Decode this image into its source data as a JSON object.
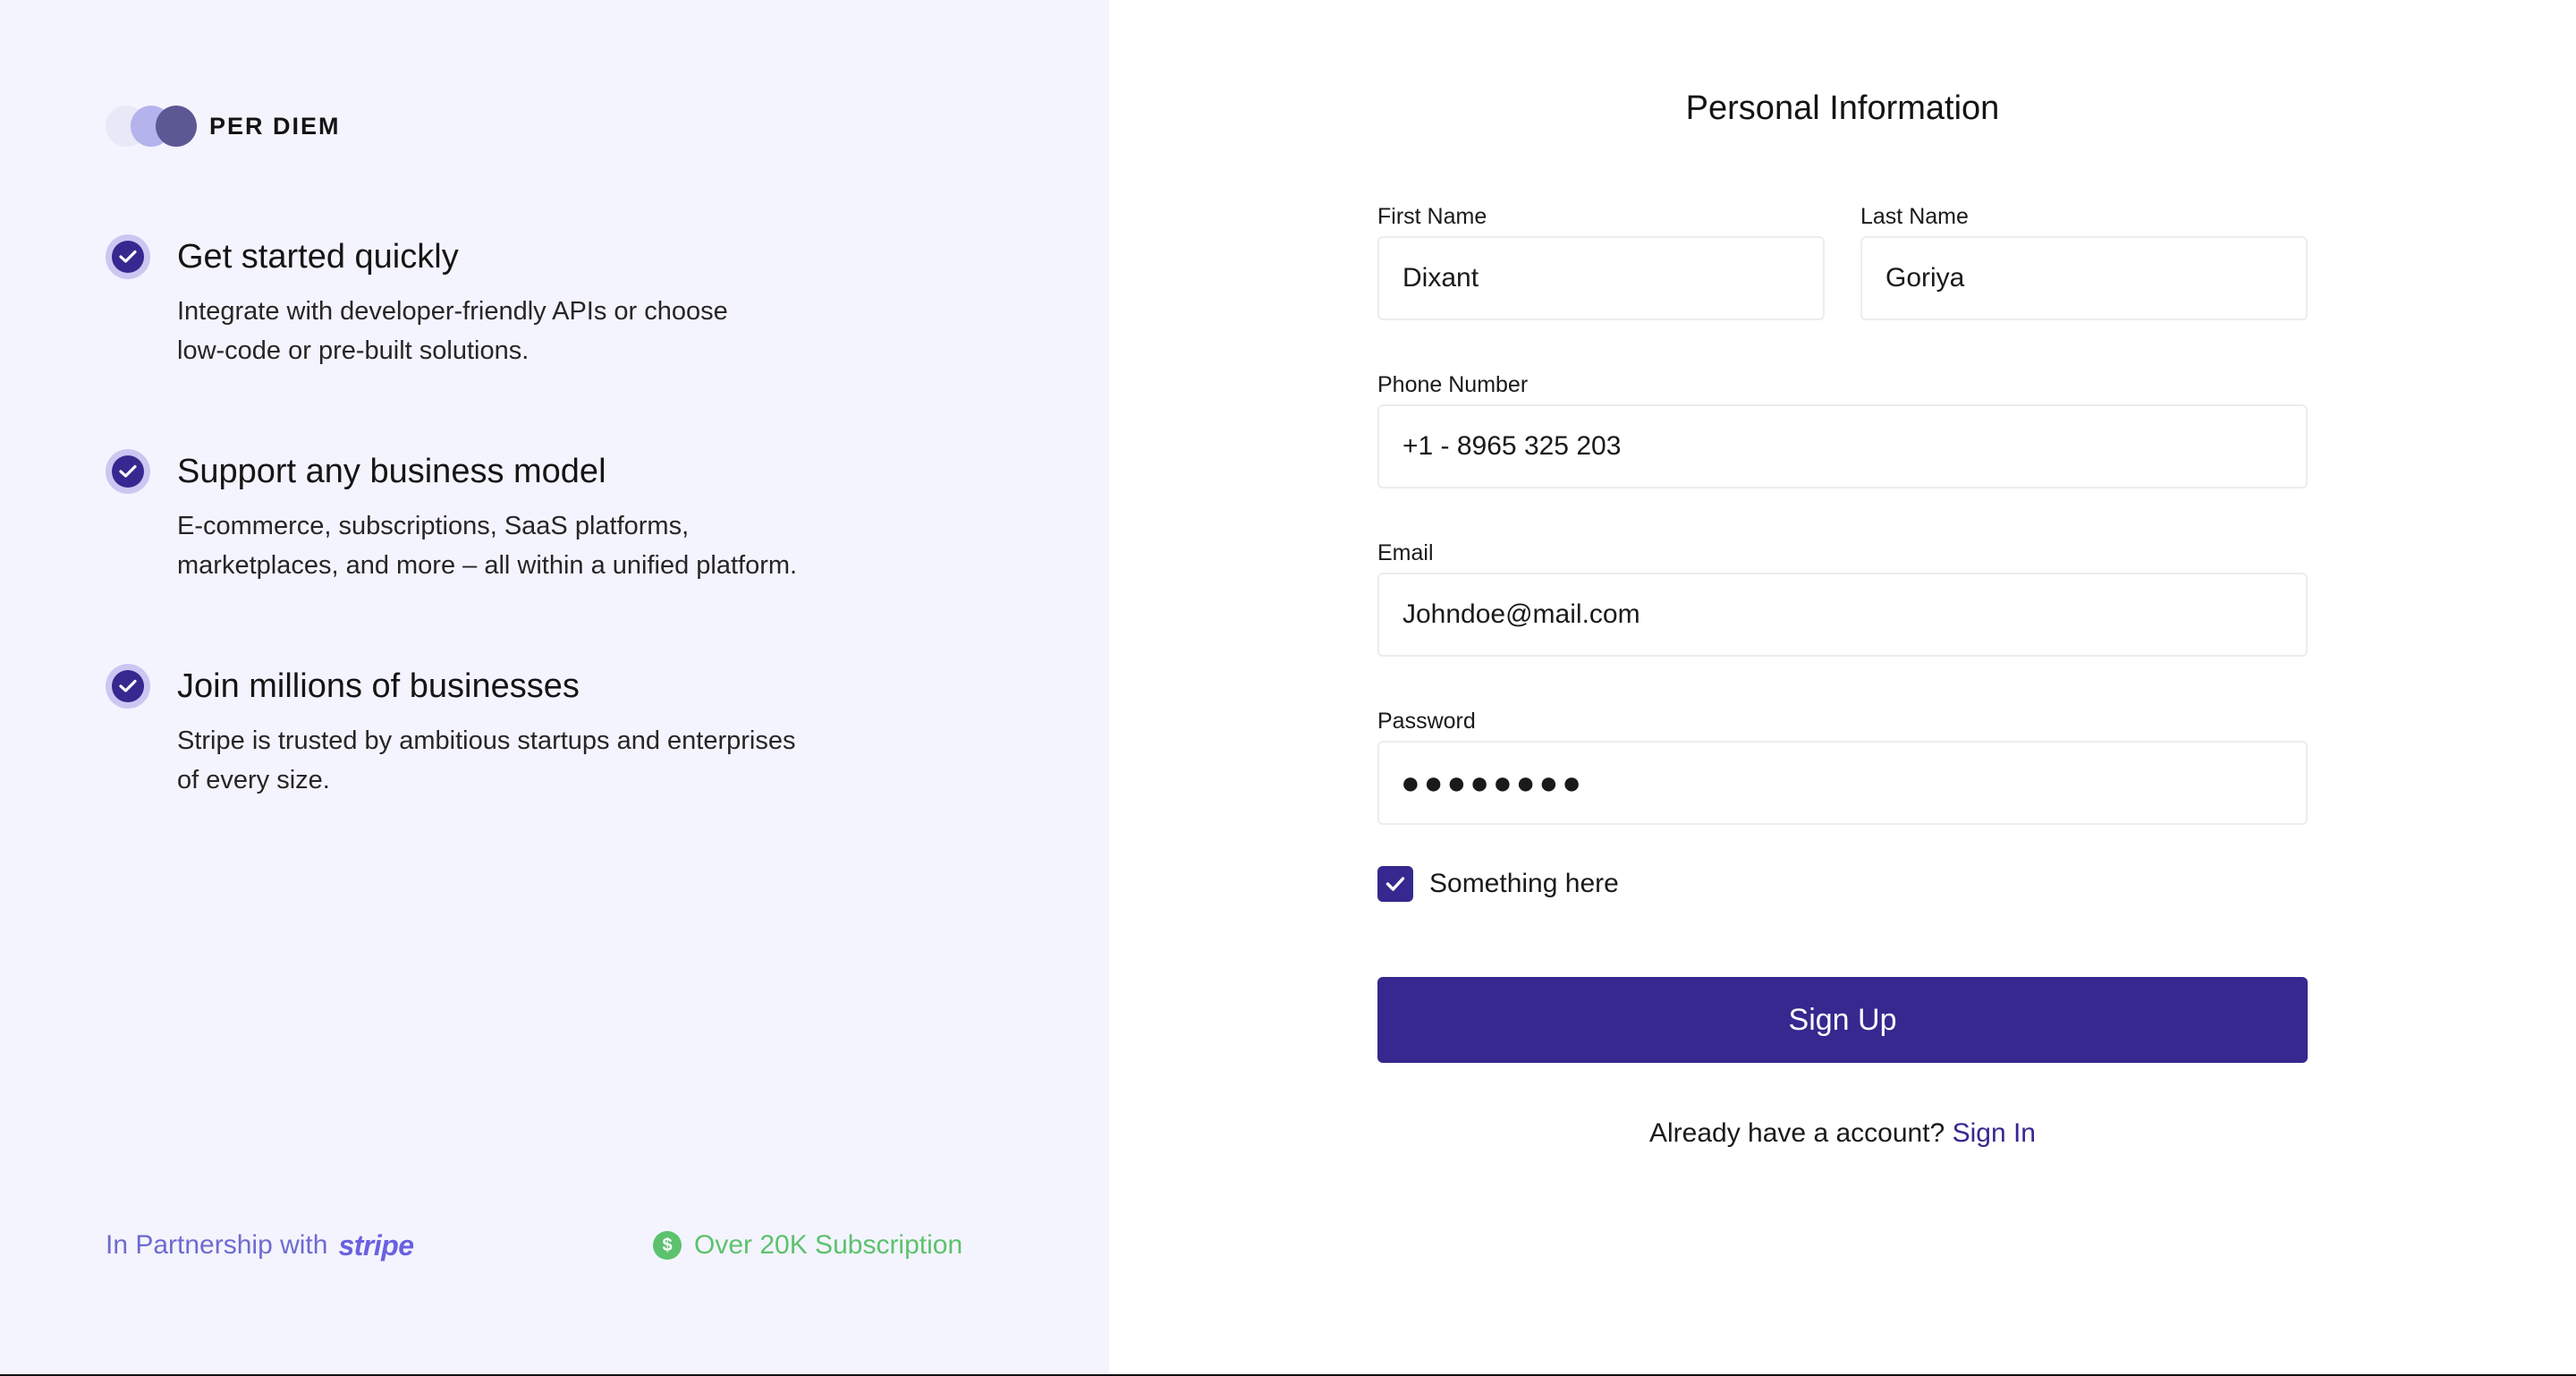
{
  "brand": {
    "name": "PER DIEM"
  },
  "features": [
    {
      "title": "Get started quickly",
      "desc_line1": "Integrate with developer-friendly APIs or choose",
      "desc_line2": "low-code or pre-built solutions."
    },
    {
      "title": "Support any business model",
      "desc_line1": "E-commerce, subscriptions, SaaS platforms,",
      "desc_line2": "marketplaces, and more – all within a unified platform."
    },
    {
      "title": "Join millions of businesses",
      "desc_line1": "Stripe is trusted by ambitious startups and enterprises",
      "desc_line2": "of every size."
    }
  ],
  "footer": {
    "partner_text": "In Partnership with",
    "partner_brand": "stripe",
    "subscription_text": "Over 20K Subscription",
    "subscription_icon": "$"
  },
  "form": {
    "title": "Personal Information",
    "first_name": {
      "label": "First Name",
      "value": "Dixant"
    },
    "last_name": {
      "label": "Last Name",
      "value": "Goriya"
    },
    "phone": {
      "label": "Phone Number",
      "value": "+1 - 8965 325 203"
    },
    "email": {
      "label": "Email",
      "value": "Johndoe@mail.com"
    },
    "password": {
      "label": "Password",
      "masked": "●●●●●●●●"
    },
    "checkbox": {
      "label": "Something here",
      "checked": true
    },
    "submit_label": "Sign Up",
    "signin_prompt": "Already have a account?",
    "signin_link": "Sign In"
  },
  "colors": {
    "accent": "#35288f",
    "left_panel_bg": "#f4f4fe",
    "partner_text": "#6d6bd1",
    "success": "#5cc26e"
  }
}
